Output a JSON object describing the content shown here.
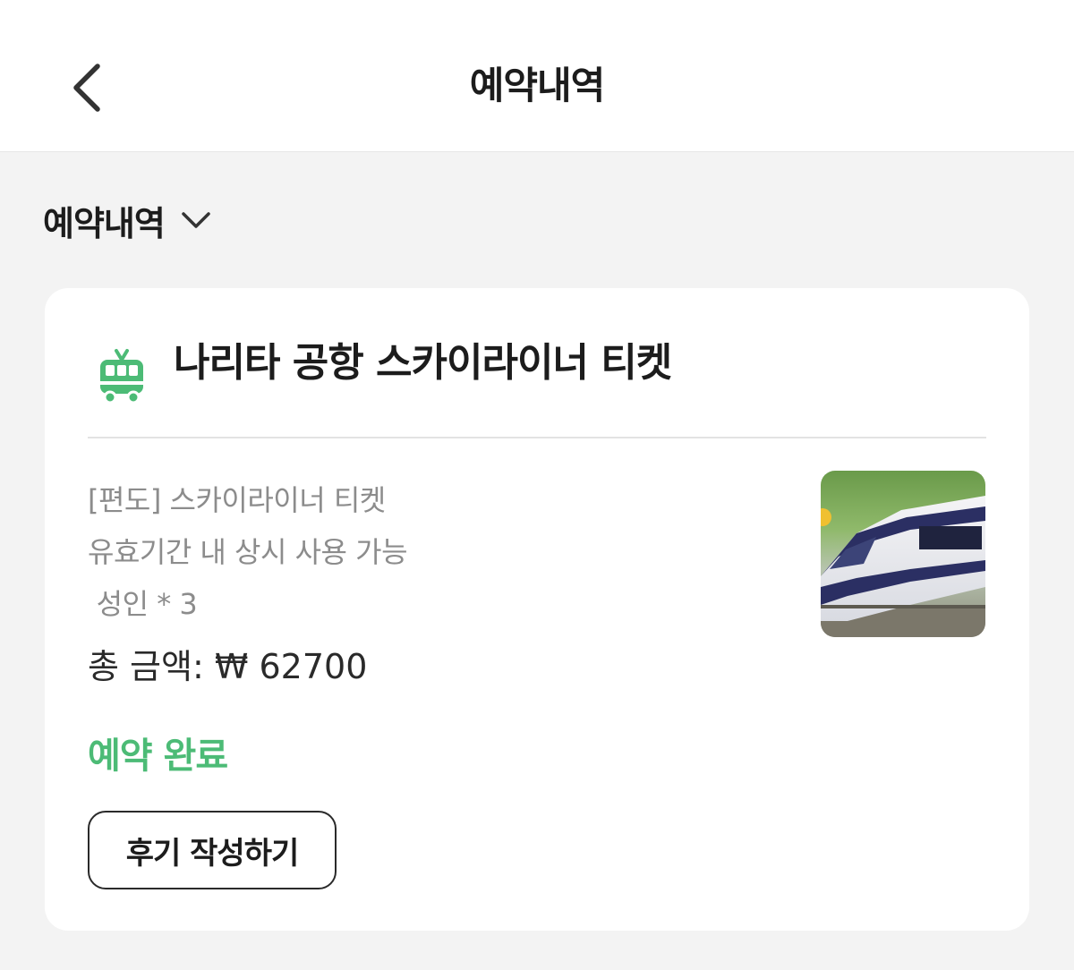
{
  "header": {
    "title": "예약내역",
    "back_icon": "chevron-left-icon"
  },
  "filter": {
    "label": "예약내역",
    "icon": "chevron-down-icon"
  },
  "reservation": {
    "icon": "tram-icon",
    "title": "나리타 공항 스카이라이너 티켓",
    "option_lines": [
      "[편도] 스카이라이너 티켓",
      "유효기간 내 상시 사용 가능",
      " 성인 * 3"
    ],
    "total": "총 금액: ₩ 62700",
    "status": "예약 완료",
    "review_button": "후기 작성하기",
    "thumbnail": "skyliner-train-photo"
  },
  "colors": {
    "accent_green": "#4cbb76",
    "background": "#f3f3f3",
    "card": "#ffffff"
  }
}
